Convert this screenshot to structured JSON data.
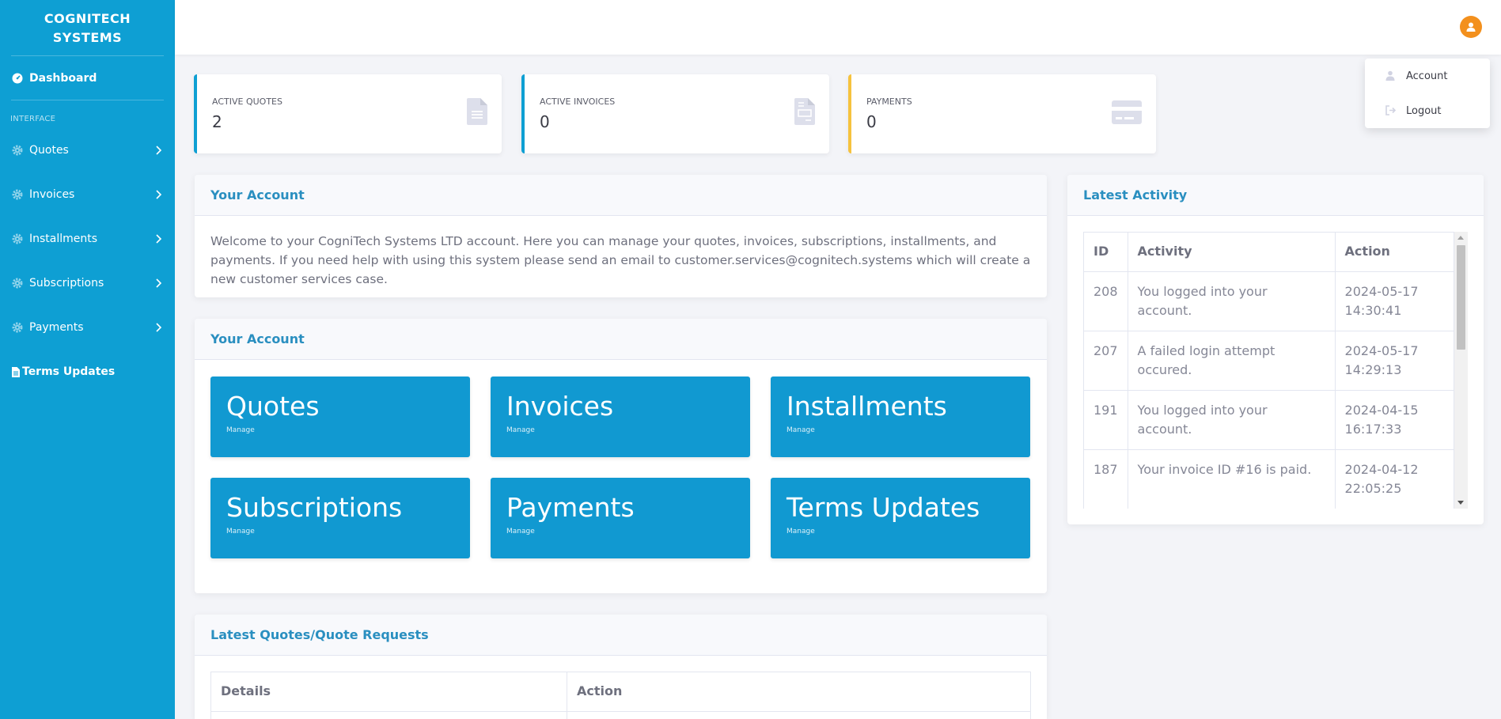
{
  "sidebar": {
    "brand_line1": "COGNITECH",
    "brand_line2": "SYSTEMS",
    "dashboard": "Dashboard",
    "section": "INTERFACE",
    "items": [
      {
        "label": "Quotes",
        "icon": "gear-icon"
      },
      {
        "label": "Invoices",
        "icon": "gear-icon"
      },
      {
        "label": "Installments",
        "icon": "gear-icon"
      },
      {
        "label": "Subscriptions",
        "icon": "gear-icon"
      },
      {
        "label": "Payments",
        "icon": "gear-icon"
      }
    ],
    "terms": "Terms Updates"
  },
  "user_menu": {
    "account": "Account",
    "logout": "Logout"
  },
  "stats": [
    {
      "title": "ACTIVE QUOTES",
      "value": "2",
      "icon": "document-icon"
    },
    {
      "title": "ACTIVE INVOICES",
      "value": "0",
      "icon": "invoice-icon"
    },
    {
      "title": "PAYMENTS",
      "value": "0",
      "icon": "credit-card-icon"
    }
  ],
  "account_card": {
    "title": "Your Account",
    "text": "Welcome to your CogniTech Systems LTD account. Here you can manage your quotes, invoices, subscriptions, installments, and payments. If you need help with using this system please send an email to customer.services@cognitech.systems which will create a new customer services case."
  },
  "shortcuts_card": {
    "title": "Your Account",
    "tiles": [
      {
        "name": "Quotes",
        "sub": "Manage"
      },
      {
        "name": "Invoices",
        "sub": "Manage"
      },
      {
        "name": "Installments",
        "sub": "Manage"
      },
      {
        "name": "Subscriptions",
        "sub": "Manage"
      },
      {
        "name": "Payments",
        "sub": "Manage"
      },
      {
        "name": "Terms Updates",
        "sub": "Manage"
      }
    ]
  },
  "quotes_card": {
    "title": "Latest Quotes/Quote Requests",
    "columns": [
      "Details",
      "Action"
    ]
  },
  "activity_card": {
    "title": "Latest Activity",
    "columns": [
      "ID",
      "Activity",
      "Action"
    ],
    "rows": [
      {
        "id": "208",
        "activity": "You logged into your account.",
        "date": "2024-05-17",
        "time": "14:30:41"
      },
      {
        "id": "207",
        "activity": "A failed login attempt occured.",
        "date": "2024-05-17",
        "time": "14:29:13"
      },
      {
        "id": "191",
        "activity": "You logged into your account.",
        "date": "2024-04-15",
        "time": "16:17:33"
      },
      {
        "id": "187",
        "activity": "Your invoice ID #16 is paid.",
        "date": "2024-04-12",
        "time": "22:05:25"
      }
    ]
  },
  "colors": {
    "sidebar": "#0e9fd3",
    "tile": "#1199d1",
    "avatar": "#f3901d",
    "payments_accent": "#f6c23e"
  }
}
